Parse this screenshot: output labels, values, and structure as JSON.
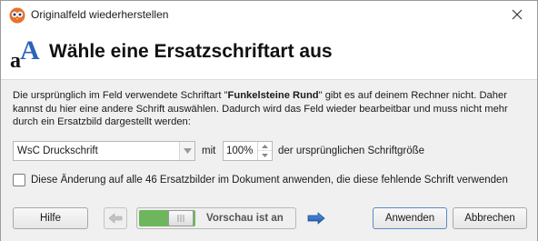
{
  "window": {
    "title": "Originalfeld wiederherstellen"
  },
  "header": {
    "icon_letters": "aA",
    "title": "Wähle eine Ersatzschriftart aus"
  },
  "description": {
    "part1": "Die ursprünglich im Feld verwendete Schriftart \"",
    "font_name": "Funkelsteine Rund",
    "part2": "\" gibt es auf deinem Rechner nicht. Daher kannst du hier eine andere Schrift auswählen. Dadurch wird das Feld wieder bearbeitbar und muss nicht mehr durch ein Ersatzbild dargestellt werden:"
  },
  "font_select": {
    "value": "WsC Druckschrift",
    "mit_label": "mit",
    "size_value": "100%",
    "size_suffix": "der ursprünglichen Schriftgröße"
  },
  "apply_all": {
    "checked": false,
    "label": "Diese Änderung auf alle 46 Ersatzbilder im Dokument anwenden, die diese fehlende Schrift verwenden"
  },
  "buttons": {
    "help": "Hilfe",
    "preview": "Vorschau ist an",
    "ok": "Anwenden",
    "cancel": "Abbrechen"
  },
  "icons": {
    "app": "owl-icon",
    "header": "font-icon",
    "close": "close-icon",
    "prev": "arrow-left-icon",
    "next": "arrow-right-icon",
    "combo": "chevron-down-icon",
    "spin_up": "chevron-up-icon",
    "spin_down": "chevron-down-icon"
  },
  "colors": {
    "toggle_on": "#6db65d",
    "accent_blue": "#2f6fc6",
    "title_a": "#2b63b8"
  }
}
